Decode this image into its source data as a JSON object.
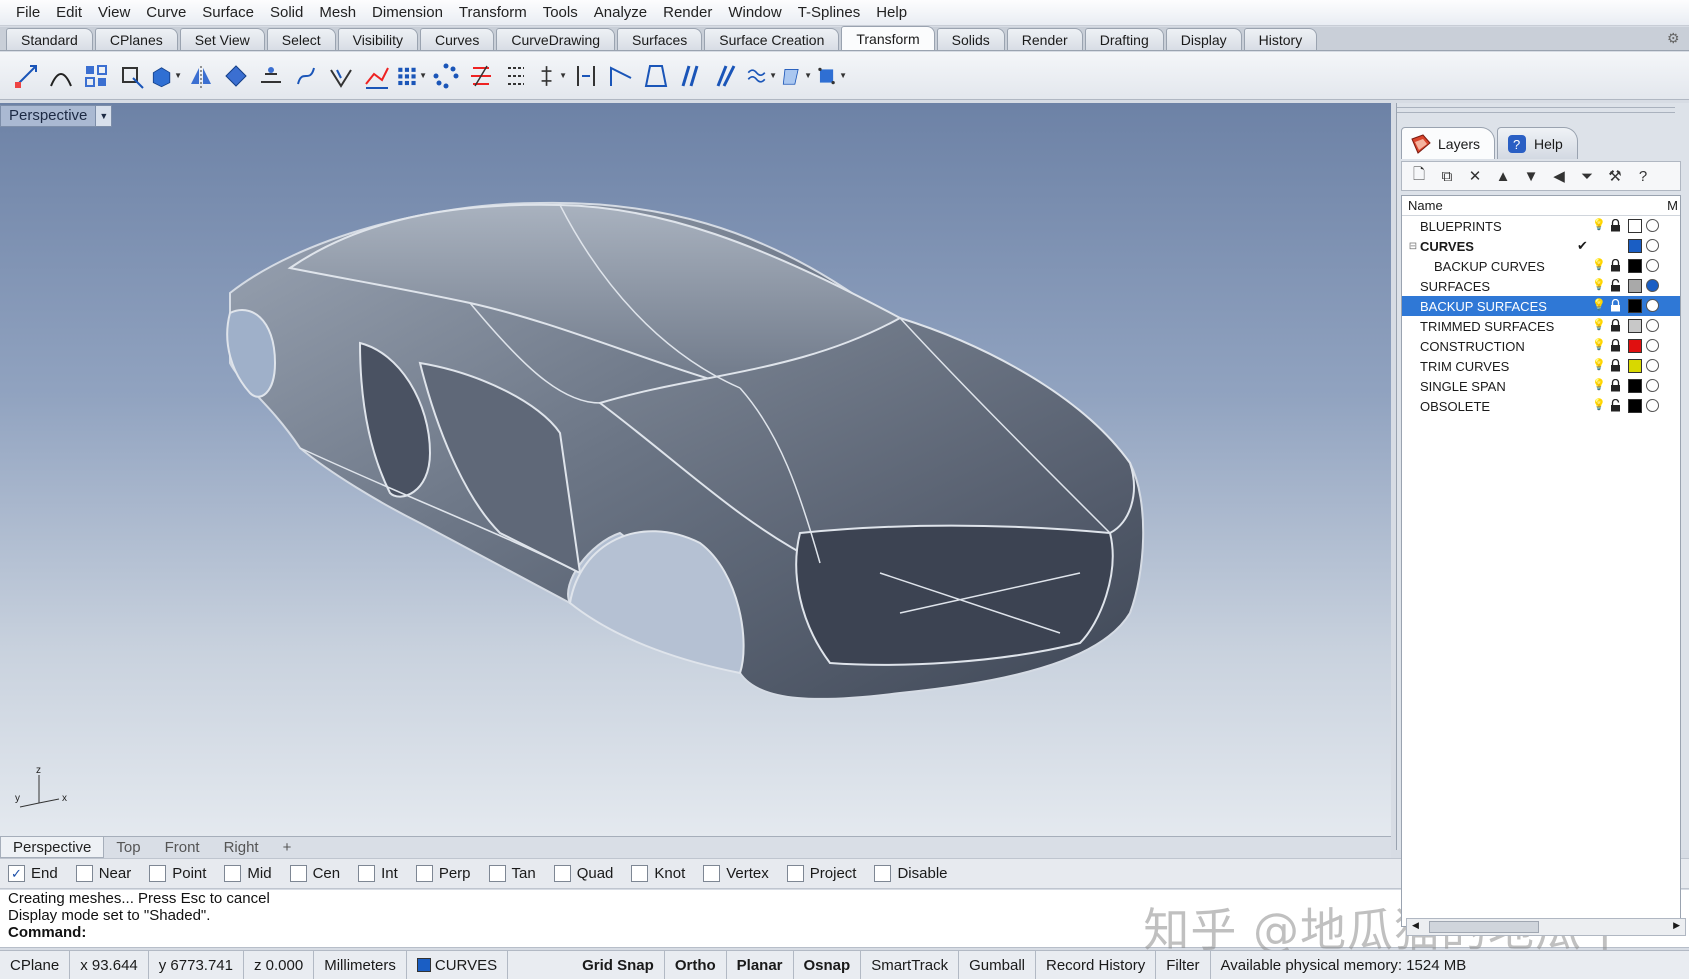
{
  "menu": [
    "File",
    "Edit",
    "View",
    "Curve",
    "Surface",
    "Solid",
    "Mesh",
    "Dimension",
    "Transform",
    "Tools",
    "Analyze",
    "Render",
    "Window",
    "T-Splines",
    "Help"
  ],
  "tabs": {
    "items": [
      "Standard",
      "CPlanes",
      "Set View",
      "Select",
      "Visibility",
      "Curves",
      "CurveDrawing",
      "Surfaces",
      "Surface Creation",
      "Transform",
      "Solids",
      "Render",
      "Drafting",
      "Display",
      "History"
    ],
    "active": "Transform"
  },
  "toolbar": {
    "icons": [
      "move-icon",
      "rotate-icon",
      "array-icon",
      "scale-icon",
      "box-edit-icon",
      "mirror-icon",
      "orient-icon",
      "project-icon",
      "twist-icon",
      "bend-icon",
      "flow-icon",
      "grid-array-icon",
      "array-polar-icon",
      "taper-icon",
      "distribute-icon",
      "align-icon",
      "stretch-icon",
      "shear-icon",
      "flow-along-srf-icon",
      "splop-icon",
      "smash-icon",
      "cage-edit-icon",
      "setpt-icon",
      "arrow-icon"
    ]
  },
  "viewport": {
    "title": "Perspective",
    "axes": {
      "z": "z",
      "y": "y",
      "x": "x"
    }
  },
  "view_tabs": [
    "Perspective",
    "Top",
    "Front",
    "Right"
  ],
  "osnaps": [
    {
      "label": "End",
      "checked": true
    },
    {
      "label": "Near",
      "checked": false
    },
    {
      "label": "Point",
      "checked": false
    },
    {
      "label": "Mid",
      "checked": false
    },
    {
      "label": "Cen",
      "checked": false
    },
    {
      "label": "Int",
      "checked": false
    },
    {
      "label": "Perp",
      "checked": false
    },
    {
      "label": "Tan",
      "checked": false
    },
    {
      "label": "Quad",
      "checked": false
    },
    {
      "label": "Knot",
      "checked": false
    },
    {
      "label": "Vertex",
      "checked": false
    },
    {
      "label": "Project",
      "checked": false
    },
    {
      "label": "Disable",
      "checked": false
    }
  ],
  "command": {
    "history": [
      "Creating meshes... Press Esc to cancel",
      "Display mode set to \"Shaded\"."
    ],
    "prompt": "Command:",
    "watermark": "知乎 @地瓜猫的地瓜干"
  },
  "status": {
    "cplane": "CPlane",
    "x": "x 93.644",
    "y": "y 6773.741",
    "z": "z 0.000",
    "units": "Millimeters",
    "layer": "CURVES",
    "layer_color": "#1a5ec4",
    "toggles": [
      "Grid Snap",
      "Ortho",
      "Planar",
      "Osnap"
    ],
    "smarttrack": "SmartTrack",
    "gumball": "Gumball",
    "record_history": "Record History",
    "filter": "Filter",
    "memory": "Available physical memory: 1524 MB"
  },
  "layers_panel": {
    "tabs": [
      "Layers",
      "Help"
    ],
    "header_name": "Name",
    "header_m": "M",
    "layers": [
      {
        "name": "BLUEPRINTS",
        "color": "#ffffff",
        "indent": false,
        "current": false,
        "bulb_on": false,
        "locked": true
      },
      {
        "name": "CURVES",
        "color": "#1a5ec4",
        "indent": false,
        "current": true,
        "bulb_on": false,
        "locked": false,
        "expandable": true
      },
      {
        "name": "BACKUP CURVES",
        "color": "#000000",
        "indent": true,
        "current": false,
        "bulb_on": false,
        "locked": true
      },
      {
        "name": "SURFACES",
        "color": "#a9a9a9",
        "indent": false,
        "current": false,
        "bulb_on": true,
        "locked": false
      },
      {
        "name": "BACKUP SURFACES",
        "color": "#000000",
        "indent": false,
        "current": false,
        "bulb_on": false,
        "locked": true,
        "selected": true
      },
      {
        "name": "TRIMMED SURFACES",
        "color": "#c8c8c8",
        "indent": false,
        "current": false,
        "bulb_on": false,
        "locked": true
      },
      {
        "name": "CONSTRUCTION",
        "color": "#e01010",
        "indent": false,
        "current": false,
        "bulb_on": false,
        "locked": true
      },
      {
        "name": "TRIM CURVES",
        "color": "#d8d800",
        "indent": false,
        "current": false,
        "bulb_on": false,
        "locked": true
      },
      {
        "name": "SINGLE SPAN",
        "color": "#000000",
        "indent": false,
        "current": false,
        "bulb_on": false,
        "locked": true
      },
      {
        "name": "OBSOLETE",
        "color": "#000000",
        "indent": false,
        "current": false,
        "bulb_on": false,
        "locked": false
      }
    ],
    "selected_color": "#2f78d6"
  }
}
